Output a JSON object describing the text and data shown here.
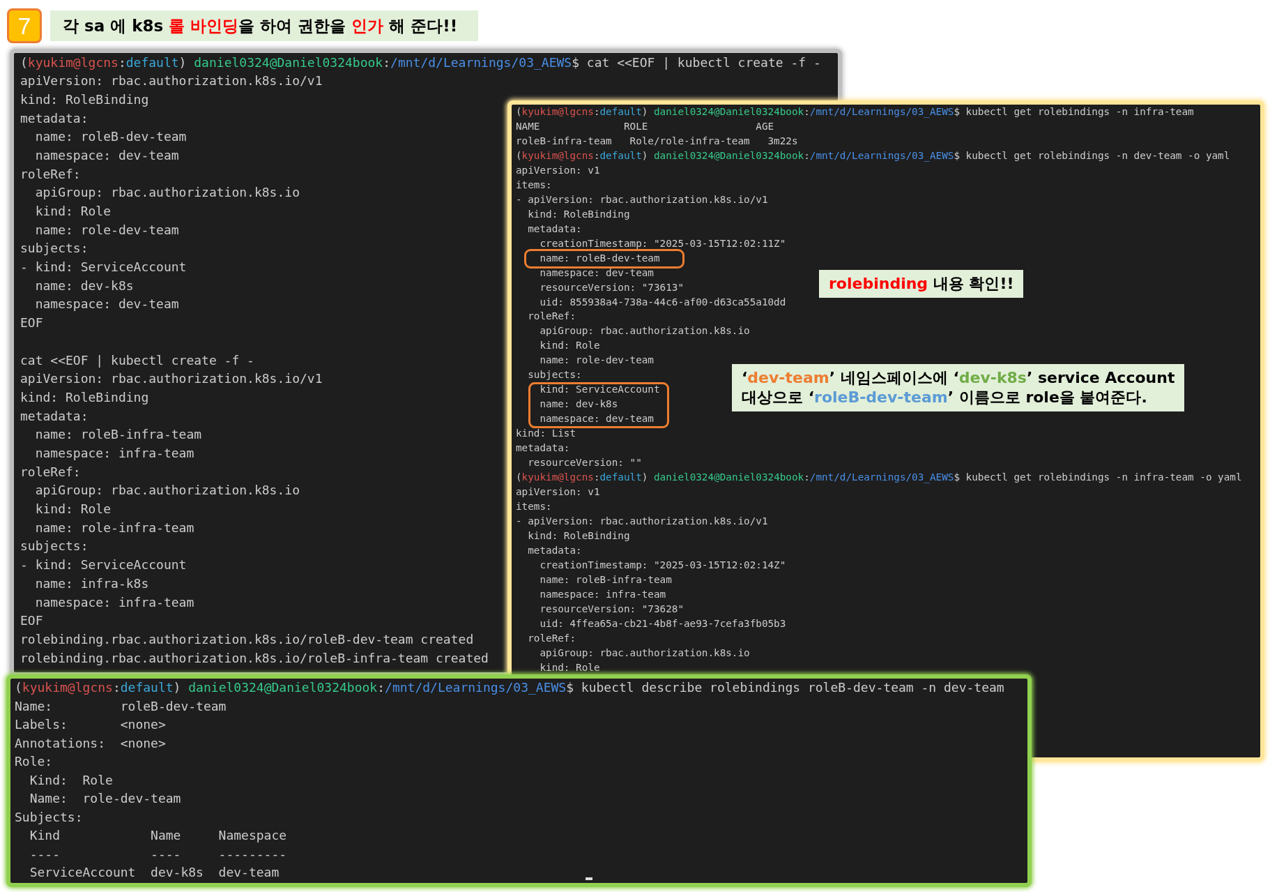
{
  "step": {
    "number": "7"
  },
  "title": {
    "segments": [
      {
        "text": "각 sa 에 k8s "
      },
      {
        "text": "롤 바인딩",
        "color": "#ff0000"
      },
      {
        "text": "을 하여 권한을 "
      },
      {
        "text": "인가",
        "color": "#ff0000"
      },
      {
        "text": " 해 준다!!"
      }
    ]
  },
  "terminals": [
    {
      "color": "#bfbfbf",
      "lines": [
        {
          "parts": [
            {
              "text": "("
            },
            {
              "text": "kyukim@lgcns",
              "color": "#d9534f"
            },
            {
              "text": ":"
            },
            {
              "text": "default",
              "color": "#3ba7d8"
            },
            {
              "text": ") "
            },
            {
              "text": "daniel0324@Daniel0324book",
              "color": "#36c98b"
            },
            {
              "text": ":"
            },
            {
              "text": "/mnt/d/Learnings/03_AEWS",
              "color": "#4a8fe7"
            },
            {
              "text": "$ cat <<EOF | kubectl create -f -"
            }
          ]
        },
        {
          "text": "apiVersion: rbac.authorization.k8s.io/v1"
        },
        {
          "text": "kind: RoleBinding"
        },
        {
          "text": "metadata:"
        },
        {
          "text": "  name: roleB-dev-team"
        },
        {
          "text": "  namespace: dev-team"
        },
        {
          "text": "roleRef:"
        },
        {
          "text": "  apiGroup: rbac.authorization.k8s.io"
        },
        {
          "text": "  kind: Role"
        },
        {
          "text": "  name: role-dev-team"
        },
        {
          "text": "subjects:"
        },
        {
          "text": "- kind: ServiceAccount"
        },
        {
          "text": "  name: dev-k8s"
        },
        {
          "text": "  namespace: dev-team"
        },
        {
          "text": "EOF"
        },
        {
          "text": "cat <<EOF | kubectl create -f -",
          "gap_before": true
        },
        {
          "text": "apiVersion: rbac.authorization.k8s.io/v1"
        },
        {
          "text": "kind: RoleBinding"
        },
        {
          "text": "metadata:"
        },
        {
          "text": "  name: roleB-infra-team"
        },
        {
          "text": "  namespace: infra-team"
        },
        {
          "text": "roleRef:"
        },
        {
          "text": "  apiGroup: rbac.authorization.k8s.io"
        },
        {
          "text": "  kind: Role"
        },
        {
          "text": "  name: role-infra-team"
        },
        {
          "text": "subjects:"
        },
        {
          "text": "- kind: ServiceAccount"
        },
        {
          "text": "  name: infra-k8s"
        },
        {
          "text": "  namespace: infra-team"
        },
        {
          "text": "EOF"
        },
        {
          "text": "rolebinding.rbac.authorization.k8s.io/roleB-dev-team created"
        },
        {
          "text": "rolebinding.rbac.authorization.k8s.io/roleB-infra-team created"
        }
      ]
    },
    {
      "color": "#ffe699",
      "lines": [
        {
          "parts": [
            {
              "text": "("
            },
            {
              "text": "kyukim@lgcns",
              "color": "#d9534f"
            },
            {
              "text": ":"
            },
            {
              "text": "default",
              "color": "#3ba7d8"
            },
            {
              "text": ") "
            },
            {
              "text": "daniel0324@Daniel0324book",
              "color": "#36c98b"
            },
            {
              "text": ":"
            },
            {
              "text": "/mnt/d/Learnings/03_AEWS",
              "color": "#4a8fe7"
            },
            {
              "text": "$ kubectl get rolebindings -n infra-team"
            }
          ]
        },
        {
          "text": "NAME              ROLE                  AGE"
        },
        {
          "text": "roleB-infra-team   Role/role-infra-team   3m22s"
        },
        {
          "parts": [
            {
              "text": "("
            },
            {
              "text": "kyukim@lgcns",
              "color": "#d9534f"
            },
            {
              "text": ":"
            },
            {
              "text": "default",
              "color": "#3ba7d8"
            },
            {
              "text": ") "
            },
            {
              "text": "daniel0324@Daniel0324book",
              "color": "#36c98b"
            },
            {
              "text": ":"
            },
            {
              "text": "/mnt/d/Learnings/03_AEWS",
              "color": "#4a8fe7"
            },
            {
              "text": "$ kubectl get rolebindings -n dev-team -o yaml"
            }
          ]
        },
        {
          "text": "apiVersion: v1"
        },
        {
          "text": "items:"
        },
        {
          "text": "- apiVersion: rbac.authorization.k8s.io/v1"
        },
        {
          "text": "  kind: RoleBinding"
        },
        {
          "text": "  metadata:"
        },
        {
          "text": "    creationTimestamp: \"2025-03-15T12:02:11Z\""
        },
        {
          "text": "    name: roleB-dev-team"
        },
        {
          "text": "    namespace: dev-team"
        },
        {
          "text": "    resourceVersion: \"73613\""
        },
        {
          "text": "    uid: 855938a4-738a-44c6-af00-d63ca55a10dd"
        },
        {
          "text": "  roleRef:"
        },
        {
          "text": "    apiGroup: rbac.authorization.k8s.io"
        },
        {
          "text": "    kind: Role"
        },
        {
          "text": "    name: role-dev-team"
        },
        {
          "text": "  subjects:"
        },
        {
          "text": "    kind: ServiceAccount"
        },
        {
          "text": "    name: dev-k8s"
        },
        {
          "text": "    namespace: dev-team"
        },
        {
          "text": "kind: List"
        },
        {
          "text": "metadata:"
        },
        {
          "text": "  resourceVersion: \"\""
        },
        {
          "parts": [
            {
              "text": "("
            },
            {
              "text": "kyukim@lgcns",
              "color": "#d9534f"
            },
            {
              "text": ":"
            },
            {
              "text": "default",
              "color": "#3ba7d8"
            },
            {
              "text": ") "
            },
            {
              "text": "daniel0324@Daniel0324book",
              "color": "#36c98b"
            },
            {
              "text": ":"
            },
            {
              "text": "/mnt/d/Learnings/03_AEWS",
              "color": "#4a8fe7"
            },
            {
              "text": "$ kubectl get rolebindings -n infra-team -o yaml"
            }
          ]
        },
        {
          "text": "apiVersion: v1"
        },
        {
          "text": "items:"
        },
        {
          "text": "- apiVersion: rbac.authorization.k8s.io/v1"
        },
        {
          "text": "  kind: RoleBinding"
        },
        {
          "text": "  metadata:"
        },
        {
          "text": "    creationTimestamp: \"2025-03-15T12:02:14Z\""
        },
        {
          "text": "    name: roleB-infra-team"
        },
        {
          "text": "    namespace: infra-team"
        },
        {
          "text": "    resourceVersion: \"73628\""
        },
        {
          "text": "    uid: 4ffea65a-cb21-4b8f-ae93-7cefa3fb05b3"
        },
        {
          "text": "  roleRef:"
        },
        {
          "text": "    apiGroup: rbac.authorization.k8s.io"
        },
        {
          "text": "    kind: Role"
        }
      ]
    },
    {
      "color": "#92d050",
      "lines": [
        {
          "parts": [
            {
              "text": "("
            },
            {
              "text": "kyukim@lgcns",
              "color": "#d9534f"
            },
            {
              "text": ":"
            },
            {
              "text": "default",
              "color": "#3ba7d8"
            },
            {
              "text": ") "
            },
            {
              "text": "daniel0324@Daniel0324book",
              "color": "#36c98b"
            },
            {
              "text": ":"
            },
            {
              "text": "/mnt/d/Learnings/03_AEWS",
              "color": "#4a8fe7"
            },
            {
              "text": "$ kubectl describe rolebindings roleB-dev-team -n dev-team"
            }
          ]
        },
        {
          "text": "Name:         roleB-dev-team"
        },
        {
          "text": "Labels:       <none>"
        },
        {
          "text": "Annotations:  <none>"
        },
        {
          "text": "Role:"
        },
        {
          "text": "  Kind:  Role"
        },
        {
          "text": "  Name:  role-dev-team"
        },
        {
          "text": "Subjects:"
        },
        {
          "text": "  Kind            Name     Namespace"
        },
        {
          "text": "  ----            ----     ---------"
        },
        {
          "text": "  ServiceAccount  dev-k8s  dev-team"
        }
      ]
    }
  ],
  "callouts": [
    {
      "lines": [
        [
          {
            "text": "rolebinding",
            "color": "#ff0000"
          },
          {
            "text": " 내용 확인!!"
          }
        ]
      ]
    },
    {
      "lines": [
        [
          {
            "text": "‘"
          },
          {
            "text": "dev-team",
            "color": "#ed7d31"
          },
          {
            "text": "’  네임스페이스에 ‘"
          },
          {
            "text": "dev-k8s",
            "color": "#70ad47"
          },
          {
            "text": "’ service Account"
          }
        ],
        [
          {
            "text": "대상으로 ‘"
          },
          {
            "text": "roleB-dev-team",
            "color": "#5b9bd5"
          },
          {
            "text": "’ 이름으로 role을 붙여준다."
          }
        ]
      ]
    }
  ]
}
